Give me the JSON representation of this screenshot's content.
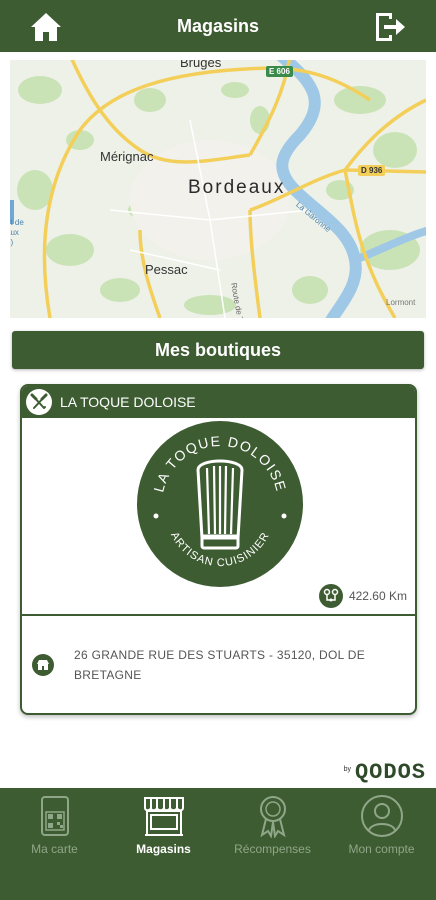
{
  "header": {
    "title": "Magasins"
  },
  "map": {
    "cities": {
      "bruges": "Bruges",
      "merignac": "Mérignac",
      "bordeaux": "Bordeaux",
      "pessac": "Pessac"
    },
    "roads": {
      "e606": "E 606",
      "d936": "D 936",
      "route_de_toul": "Route de Toul"
    },
    "river": "La Garonne",
    "edge_text": "et de\naux\n3)",
    "corner_text": "Lormont"
  },
  "section": {
    "title": "Mes boutiques"
  },
  "store": {
    "name": "LA TOQUE DOLOISE",
    "logo_top_text": "LA TOQUE DOLOISE",
    "logo_bottom_text": "ARTISAN CUISINIER",
    "distance": "422.60 Km",
    "address": "26 GRANDE RUE DES STUARTS - 35120, DOL DE BRETAGNE"
  },
  "brand": {
    "by": "by",
    "name": "QODOS"
  },
  "nav": {
    "items": [
      {
        "label": "Ma carte",
        "icon": "loyalty-card-icon",
        "active": false
      },
      {
        "label": "Magasins",
        "icon": "storefront-icon",
        "active": true
      },
      {
        "label": "Récompenses",
        "icon": "award-ribbon-icon",
        "active": false
      },
      {
        "label": "Mon compte",
        "icon": "user-account-icon",
        "active": false
      }
    ]
  },
  "colors": {
    "primary": "#3e5c32",
    "nav_inactive": "#8fa688",
    "map_road": "#f3cf5a",
    "map_water": "#9fc8e6",
    "map_park": "#c7e2b4"
  }
}
